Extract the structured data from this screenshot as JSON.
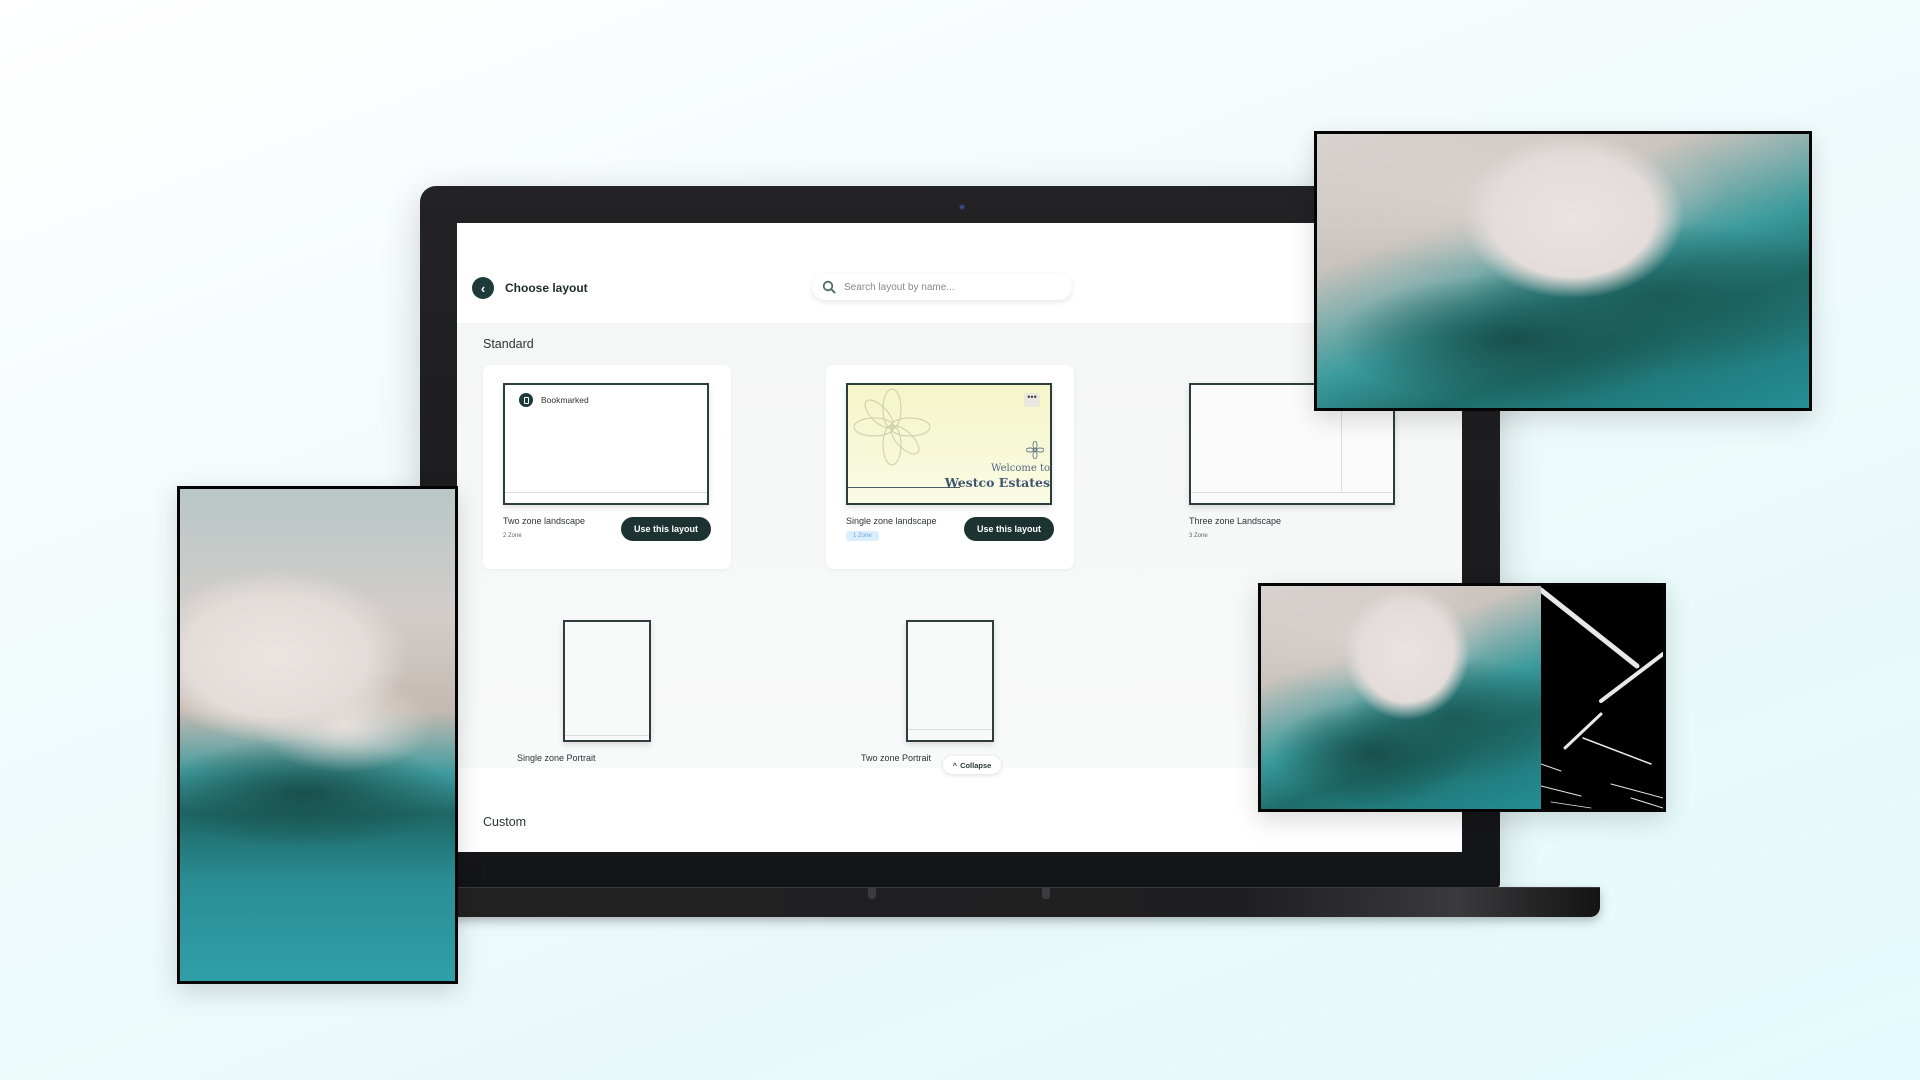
{
  "header": {
    "back_label": "Back",
    "title": "Choose layout",
    "search_placeholder": "Search layout by name..."
  },
  "sections": {
    "standard_title": "Standard",
    "custom_title": "Custom"
  },
  "layouts": [
    {
      "name": "Two zone landscape",
      "zones": "2 Zone",
      "bookmark_label": "Bookmarked",
      "button": "Use this layout"
    },
    {
      "name": "Single zone landscape",
      "zones": "1 Zone",
      "button": "Use this layout",
      "preview_line1": "Welcome to",
      "preview_line2": "Westco Estates",
      "more_label": "•••"
    },
    {
      "name": "Three zone Landscape",
      "zones": "3 Zone"
    },
    {
      "name": "Single zone Portrait"
    },
    {
      "name": "Two zone Portrait"
    }
  ],
  "collapse_label": "Collapse",
  "icons": {
    "back": "‹",
    "collapse": "^"
  },
  "colors": {
    "primary_dark": "#1c3332",
    "badge_bg": "#dbeefe",
    "badge_text": "#6aa2d8",
    "teal_water": "#2a8e95"
  }
}
